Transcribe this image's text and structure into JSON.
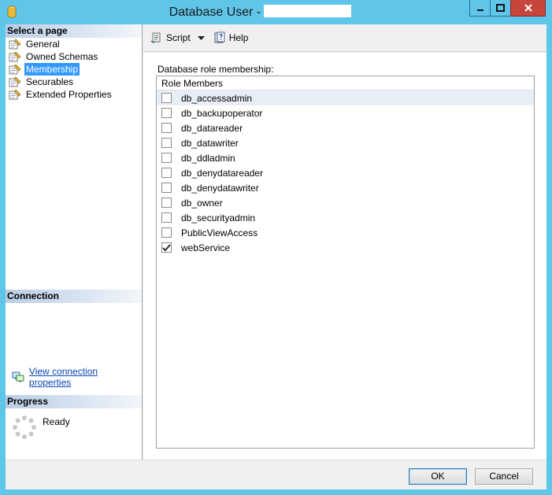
{
  "window": {
    "title": "Database User -",
    "colors": {
      "frame": "#5fc6ea",
      "close": "#c7453b",
      "selection": "#3399ff",
      "link": "#0b45b0"
    }
  },
  "left": {
    "select_page_header": "Select a page",
    "pages": [
      {
        "label": "General",
        "icon": "page-wrench-icon",
        "selected": false
      },
      {
        "label": "Owned Schemas",
        "icon": "page-wrench-icon",
        "selected": false
      },
      {
        "label": "Membership",
        "icon": "page-wrench-icon",
        "selected": true
      },
      {
        "label": "Securables",
        "icon": "page-wrench-icon",
        "selected": false
      },
      {
        "label": "Extended Properties",
        "icon": "page-wrench-icon",
        "selected": false
      }
    ],
    "connection_header": "Connection",
    "connection_link": "View connection properties",
    "progress_header": "Progress",
    "progress_status": "Ready"
  },
  "toolbar": {
    "script_label": "Script",
    "help_label": "Help"
  },
  "membership": {
    "grid_label": "Database role membership:",
    "column_header": "Role Members",
    "roles": [
      {
        "name": "db_accessadmin",
        "checked": false
      },
      {
        "name": "db_backupoperator",
        "checked": false
      },
      {
        "name": "db_datareader",
        "checked": false
      },
      {
        "name": "db_datawriter",
        "checked": false
      },
      {
        "name": "db_ddladmin",
        "checked": false
      },
      {
        "name": "db_denydatareader",
        "checked": false
      },
      {
        "name": "db_denydatawriter",
        "checked": false
      },
      {
        "name": "db_owner",
        "checked": false
      },
      {
        "name": "db_securityadmin",
        "checked": false
      },
      {
        "name": "PublicViewAccess",
        "checked": false
      },
      {
        "name": "webService",
        "checked": true
      }
    ]
  },
  "buttons": {
    "ok": "OK",
    "cancel": "Cancel"
  }
}
